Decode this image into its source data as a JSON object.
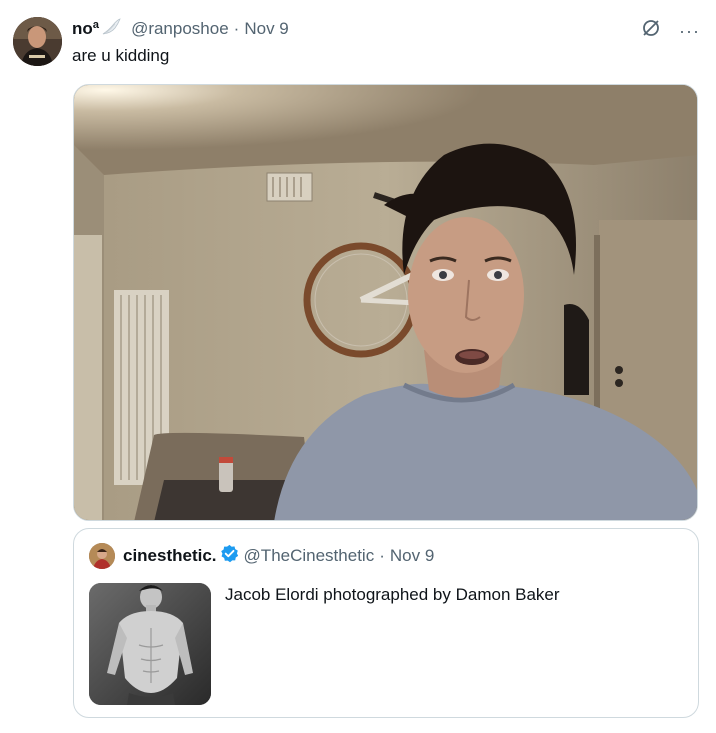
{
  "tweet": {
    "display_name": "noª",
    "handle": "@ranposhoe",
    "separator": "·",
    "date": "Nov 9",
    "text": "are u kidding",
    "avatar_icon": "user-avatar",
    "name_emoji_icon": "wing-icon",
    "actions": [
      "grok-icon",
      "more-icon"
    ],
    "more_label": "···"
  },
  "quoted_tweet": {
    "display_name": "cinesthetic.",
    "handle": "@TheCinesthetic",
    "separator": "·",
    "date": "Nov 9",
    "text": "Jacob Elordi photographed by Damon Baker",
    "verified": true,
    "avatar_icon": "user-avatar"
  },
  "colors": {
    "text_primary": "#0f1419",
    "text_secondary": "#536471",
    "border": "#cfd9de",
    "verified_blue": "#1d9bf0"
  }
}
